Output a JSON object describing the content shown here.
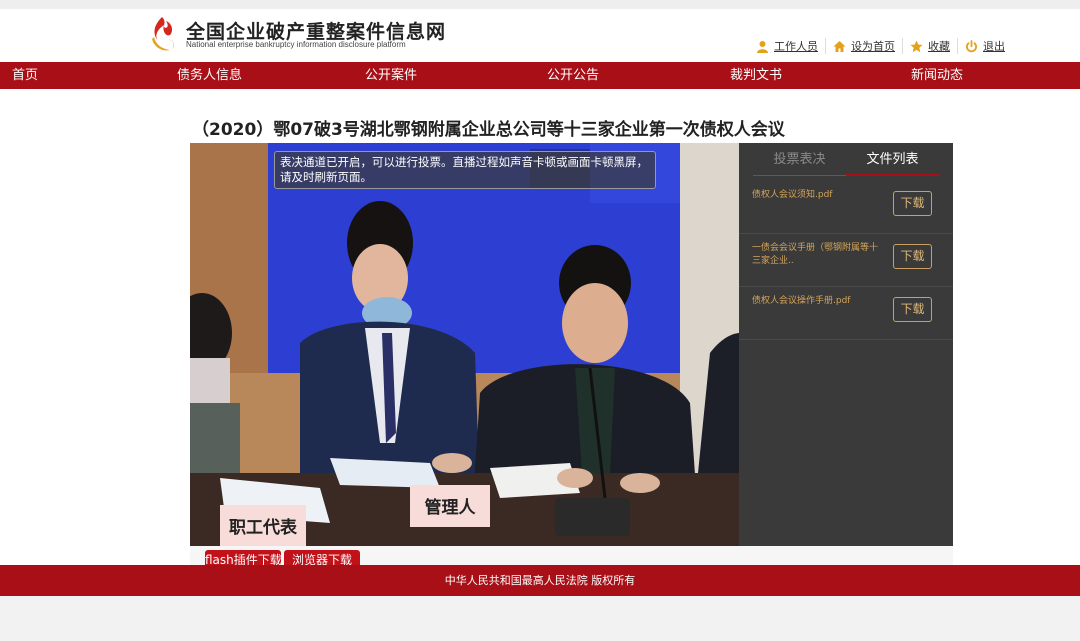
{
  "site": {
    "title": "全国企业破产重整案件信息网",
    "subtitle": "National enterprise bankruptcy  information disclosure platform"
  },
  "userlinks": [
    {
      "label": "工作人员",
      "icon": "user-icon"
    },
    {
      "label": "设为首页",
      "icon": "home-icon"
    },
    {
      "label": "收藏",
      "icon": "star-icon"
    },
    {
      "label": "退出",
      "icon": "power-icon"
    }
  ],
  "nav": [
    "首页",
    "债务人信息",
    "公开案件",
    "公开公告",
    "裁判文书",
    "新闻动态"
  ],
  "meeting": {
    "title": "（2020）鄂07破3号湖北鄂钢附属企业总公司等十三家企业第一次债权人会议"
  },
  "video": {
    "notice": "表决通道已开启，可以进行投票。直播过程如声音卡顿或画面卡顿黑屏，请及时刷新页面。",
    "nameplate_left": "职工代表",
    "nameplate_right": "管理人"
  },
  "side": {
    "tabs": [
      "投票表决",
      "文件列表"
    ],
    "active_tab": "文件列表",
    "files": [
      {
        "name": "债权人会议须知.pdf",
        "action": "下载"
      },
      {
        "name": "一债会会议手册（鄂钢附属等十三家企业..",
        "action": "下载"
      },
      {
        "name": "债权人会议操作手册.pdf",
        "action": "下载"
      }
    ]
  },
  "bottom_buttons": [
    "flash插件下载",
    "浏览器下载"
  ],
  "footer": {
    "text": "中华人民共和国最高人民法院 版权所有"
  },
  "colors": {
    "brand_red": "#a80f16",
    "accent_gold": "#d4a45a"
  }
}
